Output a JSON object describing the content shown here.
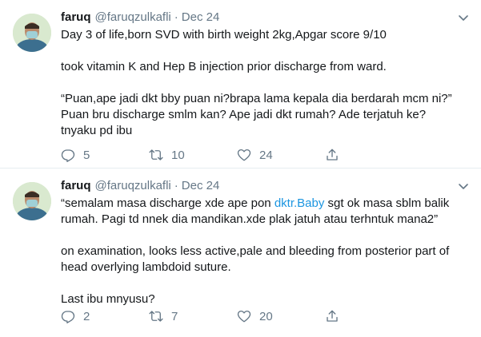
{
  "tweets": [
    {
      "name": "faruq",
      "handle": "@faruqzulkafli",
      "separator": "·",
      "date": "Dec 24",
      "lines": [
        "Day 3 of life,born SVD with birth weight 2kg,Apgar score 9/10",
        "",
        "took vitamin K and Hep B injection prior discharge from ward.",
        "",
        "“Puan,ape jadi dkt bby puan ni?brapa lama kepala dia berdarah mcm ni?”",
        "Puan bru discharge smlm kan? Ape jadi dkt rumah? Ade terjatuh ke?",
        "tnyaku pd ibu"
      ],
      "replies": "5",
      "retweets": "10",
      "likes": "24"
    },
    {
      "name": "faruq",
      "handle": "@faruqzulkafli",
      "separator": "·",
      "date": "Dec 24",
      "line1_pre": "“semalam masa discharge xde ape pon ",
      "line1_link": "dktr.Baby",
      "line1_post": " sgt ok masa sblm balik",
      "lines": [
        "rumah. Pagi td nnek dia mandikan.xde plak jatuh atau terhntuk mana2”",
        "",
        "on examination, looks less active,pale and bleeding from posterior part of",
        "head overlying lambdoid suture.",
        "",
        "Last ibu mnyusu?"
      ],
      "replies": "2",
      "retweets": "7",
      "likes": "20"
    }
  ],
  "colors": {
    "text": "#14171a",
    "muted": "#657786",
    "link": "#1b95e0",
    "divider": "#e6ecf0"
  },
  "icons": [
    "avatar-photo",
    "chevron-down-icon",
    "reply-icon",
    "retweet-icon",
    "like-icon",
    "share-icon"
  ]
}
